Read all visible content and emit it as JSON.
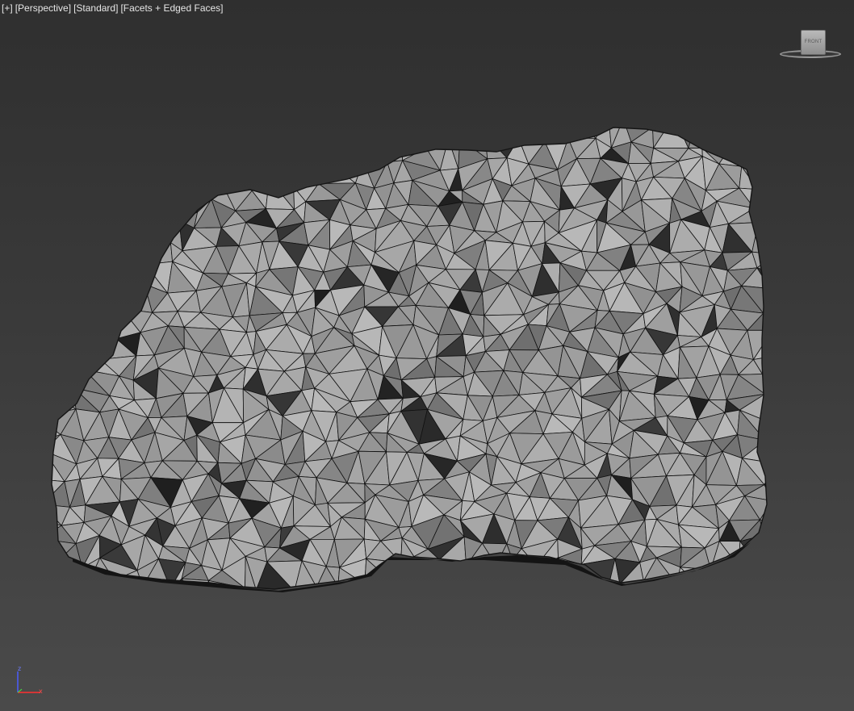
{
  "viewport": {
    "label_items": [
      "[+]",
      "[Perspective]",
      "[Standard]",
      "[Facets + Edged Faces]"
    ],
    "background_top": "#2f2f2f",
    "background_bottom": "#4a4a4a"
  },
  "viewcube": {
    "face_label": "FRONT"
  },
  "mesh": {
    "object": "rock",
    "shading": "Facets + Edged Faces",
    "base_color": "#9e9e9e",
    "edge_color": "#111111"
  },
  "axis_tripod": {
    "z_label": "z",
    "x_label": "x",
    "z_color": "#4a5cff",
    "x_color": "#ff3030"
  }
}
